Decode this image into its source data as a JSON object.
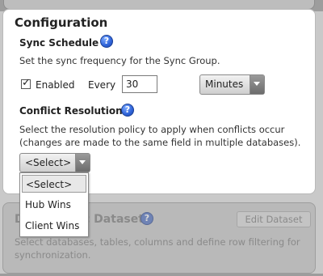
{
  "config": {
    "title": "Configuration",
    "sync_schedule": {
      "heading": "Sync Schedule",
      "help_icon": "help-icon",
      "description": "Set the sync frequency for the Sync Group.",
      "enabled_label": "Enabled",
      "enabled_checked": true,
      "every_label": "Every",
      "every_value": "30",
      "unit_selected": "Minutes"
    },
    "conflict_resolution": {
      "heading": "Conflict Resolution",
      "help_icon": "help-icon",
      "description_line1": "Select the resolution policy to apply when conflicts occur",
      "description_line2": "(changes are made to the same field in multiple databases).",
      "select_value": "<Select>",
      "options": [
        "<Select>",
        "Hub Wins",
        "Client Wins"
      ]
    }
  },
  "dataset": {
    "title": "Define Sync Dataset",
    "title_visible_start": "D",
    "title_visible_end": "Dataset",
    "edit_button_label": "Edit Dataset",
    "description_line1": "Select databases, tables, columns and define row filtering for",
    "description_line2": "synchronization."
  },
  "icons": {
    "help": "question-mark-icon",
    "dropdown_arrow": "chevron-down-icon",
    "checkmark": "checkmark-icon"
  },
  "colors": {
    "help_icon_blue": "#2f63d8",
    "overlay_gray": "#b9b9b9"
  }
}
